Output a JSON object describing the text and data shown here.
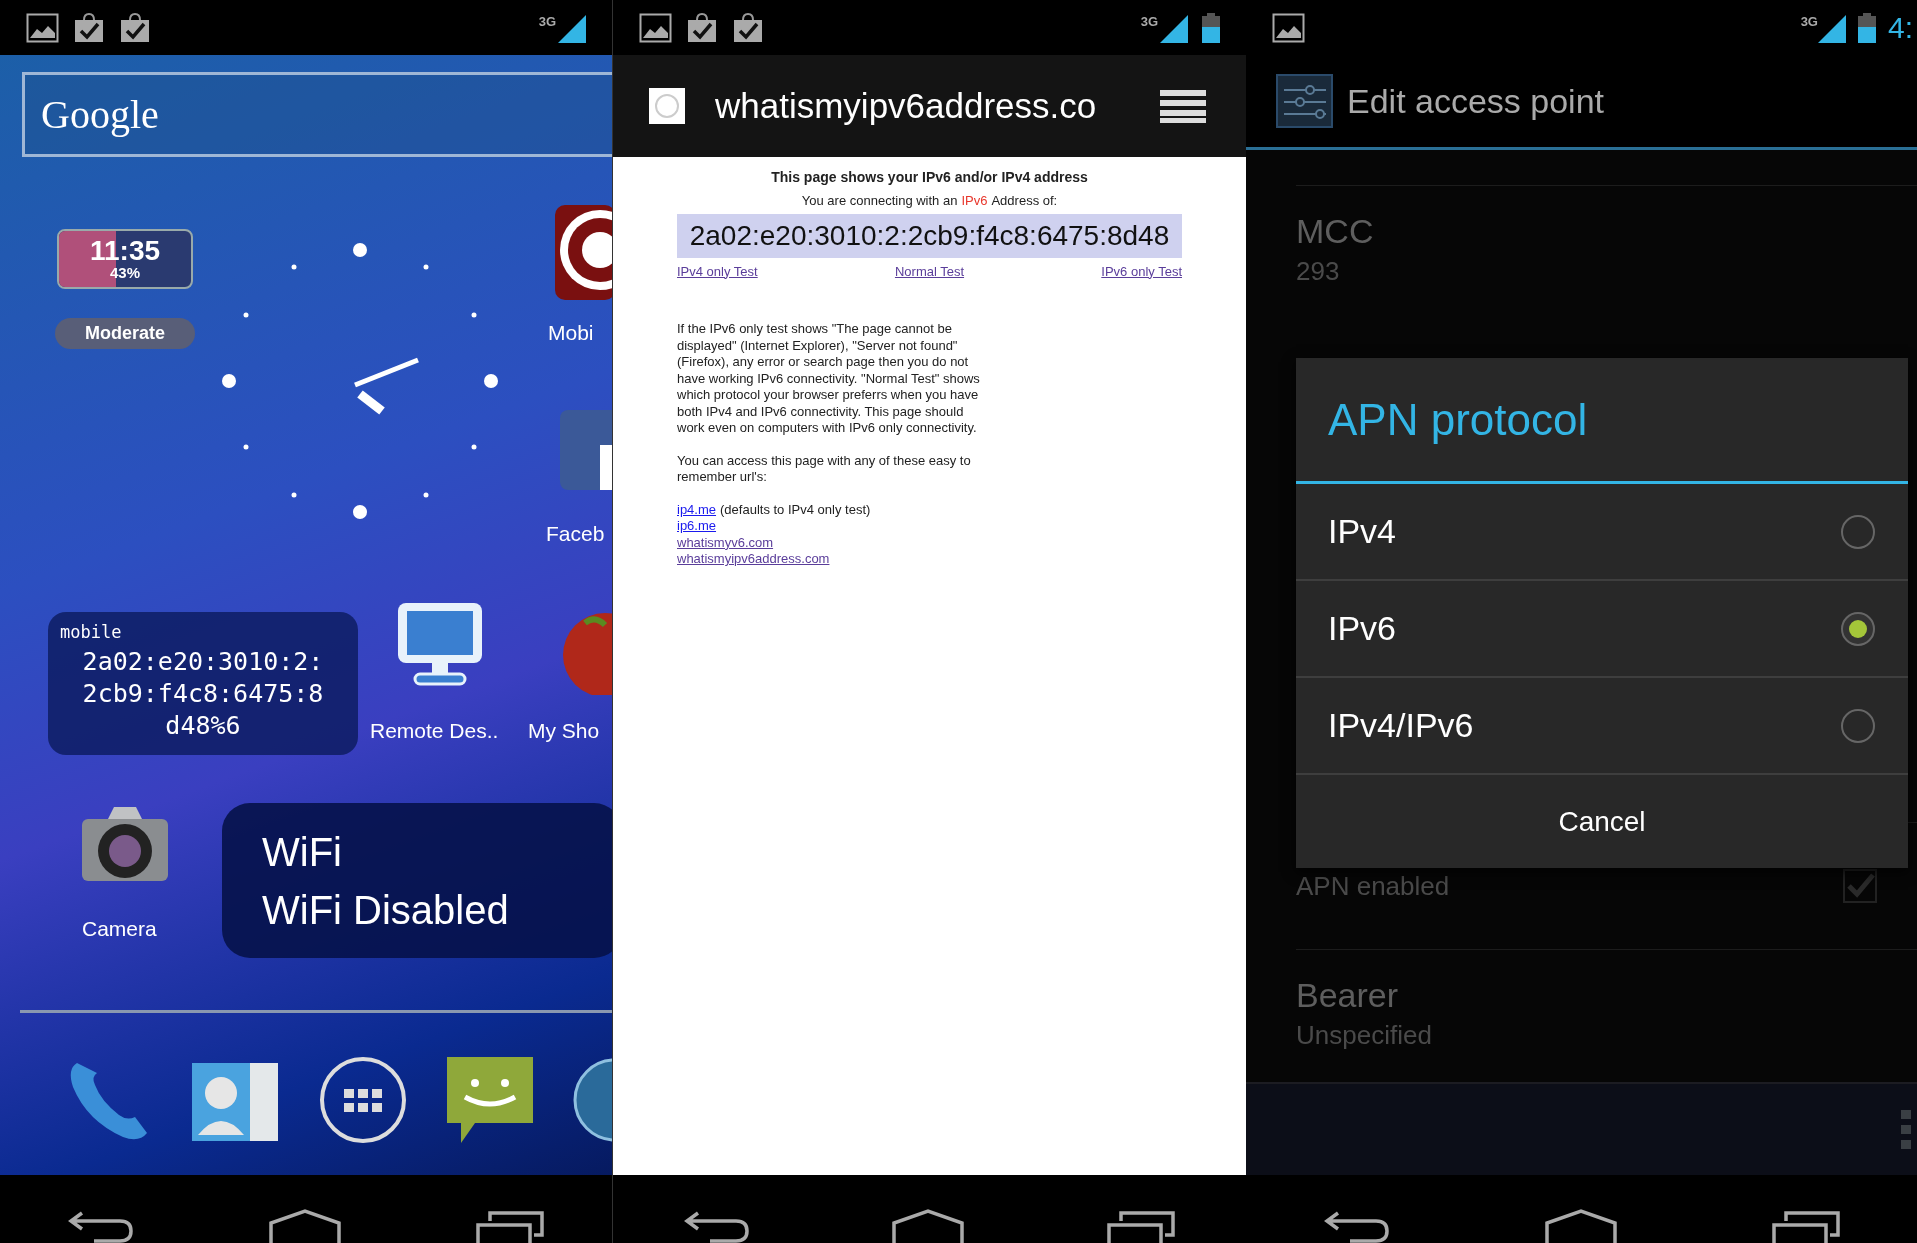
{
  "home_screen": {
    "status_bar": {
      "notifications": [
        {
          "kind": "picture"
        },
        {
          "kind": "task"
        },
        {
          "kind": "task"
        }
      ],
      "network": "3G",
      "battery": false
    },
    "search_widget": {
      "logo": "Google"
    },
    "battery_widget": {
      "time": "11:35",
      "percent": "43%",
      "level": 0.43,
      "mode": "Moderate"
    },
    "apps": [
      {
        "label": "Mobi"
      },
      {
        "label": "Faceb"
      },
      {
        "label": "Remote Des.."
      },
      {
        "label": "My Sho"
      },
      {
        "label": "Camera"
      }
    ],
    "ip_widget": {
      "network": "mobile",
      "address_lines": [
        "2a02:e20:3010:2:",
        "2cb9:f4c8:6475:8",
        "d48%6"
      ]
    },
    "wifi_widget": {
      "title": "WiFi",
      "status": "WiFi Disabled"
    }
  },
  "browser": {
    "status_bar": {
      "notifications": [
        {
          "kind": "picture"
        },
        {
          "kind": "task"
        },
        {
          "kind": "task"
        }
      ],
      "network": "3G",
      "battery": true
    },
    "url": "whatismyipv6address.co",
    "heading": "This page shows your IPv6 and/or IPv4 address",
    "connection": {
      "prefix": "You are connecting with an",
      "protocol": "IPv6",
      "suffix": "Address of:"
    },
    "address": "2a02:e20:3010:2:2cb9:f4c8:6475:8d48",
    "test_links": [
      {
        "text": "IPv4 only Test",
        "visited": true
      },
      {
        "text": "Normal Test",
        "visited": true
      },
      {
        "text": "IPv6 only Test",
        "visited": true
      }
    ],
    "paragraphs": [
      "If the IPv6 only test shows \"The page cannot be displayed\" (Internet Explorer), \"Server not found\" (Firefox), any error or search page then you do not have working IPv6 connectivity. \"Normal Test\" shows which protocol your browser preferrs when you have both IPv4 and IPv6 connectivity. This page should work even on computers with IPv6 only connectivity.",
      "You can access this page with any of these easy to remember url's:"
    ],
    "url_links": [
      {
        "text": "ip4.me",
        "note": "(defaults to IPv4 only test)",
        "visited": false
      },
      {
        "text": "ip6.me",
        "visited": false
      },
      {
        "text": "whatismyv6.com",
        "visited": true
      },
      {
        "text": "whatismyipv6address.com",
        "visited": true
      }
    ]
  },
  "settings": {
    "status_bar": {
      "notifications": [
        {
          "kind": "picture"
        }
      ],
      "network": "3G",
      "battery": true,
      "time": "4:"
    },
    "title": "Edit access point",
    "items": [
      {
        "kind": "value",
        "label": "MCC",
        "value": "293"
      },
      {
        "kind": "checkbox",
        "value": "APN enabled",
        "checked": true
      },
      {
        "kind": "value",
        "label": "Bearer",
        "value": "Unspecified"
      }
    ],
    "dialog": {
      "title": "APN protocol",
      "options": [
        {
          "label": "IPv4",
          "selected": false
        },
        {
          "label": "IPv6",
          "selected": true
        },
        {
          "label": "IPv4/IPv6",
          "selected": false
        }
      ],
      "cancel": "Cancel"
    }
  }
}
